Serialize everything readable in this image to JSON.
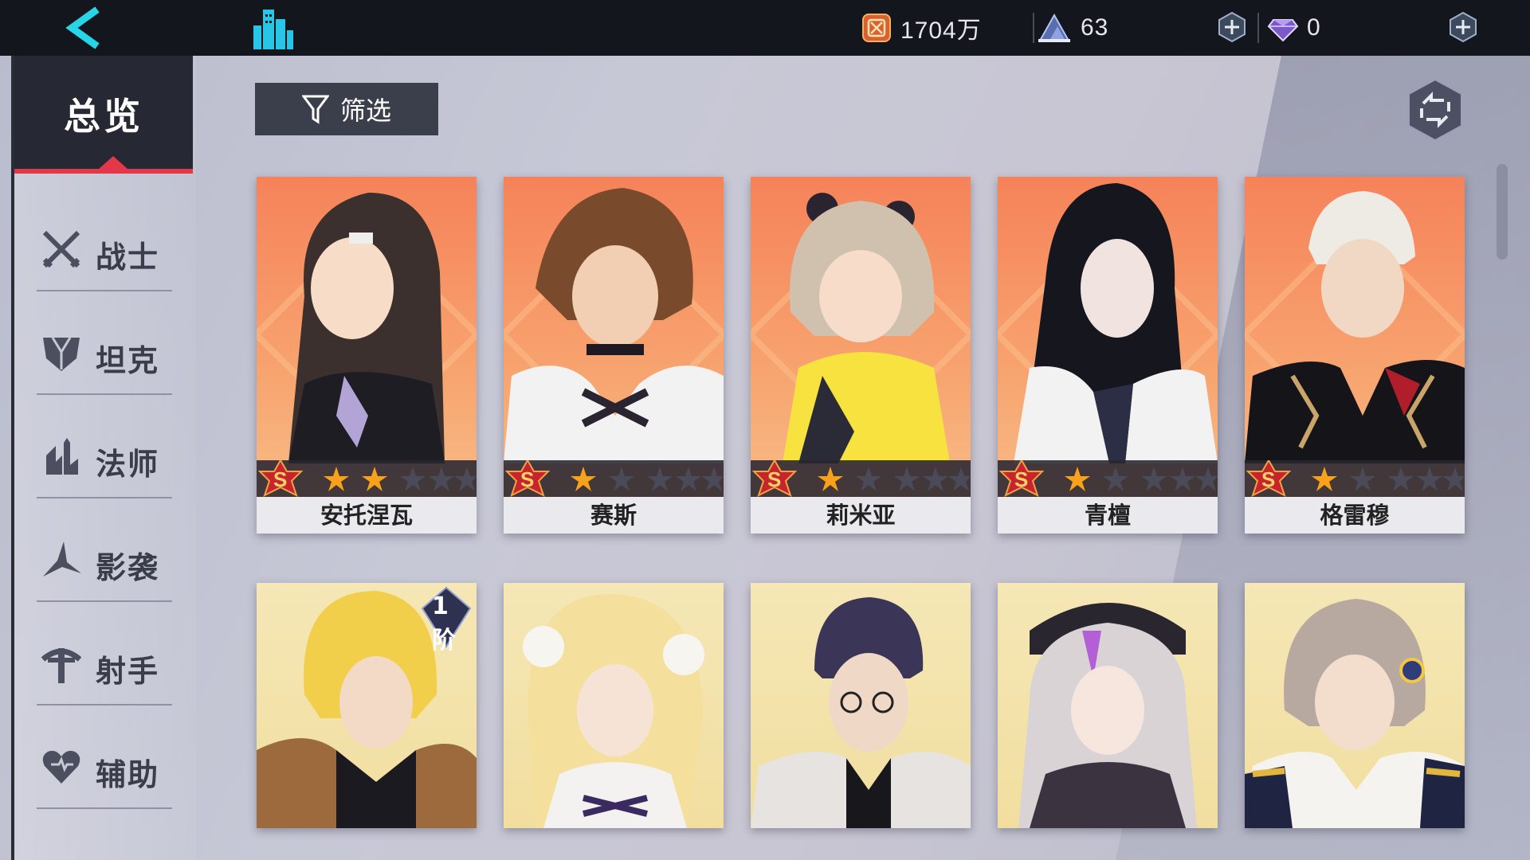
{
  "topbar": {
    "gold_amount": "1704万",
    "stamina_amount": "63",
    "gem_amount": "0",
    "icons": [
      "back-arrow-icon",
      "city-icon",
      "gold-coin-icon",
      "stamina-mountain-icon",
      "plus-icon",
      "gem-icon",
      "plus-icon"
    ]
  },
  "sidebar": {
    "overview_label": "总览",
    "items": [
      {
        "label": "战士",
        "icon": "crossed-swords-icon"
      },
      {
        "label": "坦克",
        "icon": "shield-icon"
      },
      {
        "label": "法师",
        "icon": "staff-icon"
      },
      {
        "label": "影袭",
        "icon": "shuriken-icon"
      },
      {
        "label": "射手",
        "icon": "bow-icon"
      },
      {
        "label": "辅助",
        "icon": "heart-icon"
      }
    ]
  },
  "toolbar": {
    "filter_label": "筛选"
  },
  "cards_row1": [
    {
      "name": "安托涅瓦",
      "rank": "S",
      "stars": 2,
      "max_stars": 6
    },
    {
      "name": "赛斯",
      "rank": "S",
      "stars": 1,
      "max_stars": 6
    },
    {
      "name": "莉米亚",
      "rank": "S",
      "stars": 1,
      "max_stars": 6
    },
    {
      "name": "青檀",
      "rank": "S",
      "stars": 1,
      "max_stars": 6
    },
    {
      "name": "格雷穆",
      "rank": "S",
      "stars": 1,
      "max_stars": 6
    }
  ],
  "cards_row2": [
    {
      "tier_badge": "1阶"
    },
    {},
    {},
    {},
    {}
  ],
  "colors": {
    "topbar": "#14161d",
    "accent_red": "#e2384a",
    "card_orange": "#f6825a",
    "card_yellow": "#f5e7b6",
    "star_gold": "#f7a21a"
  }
}
